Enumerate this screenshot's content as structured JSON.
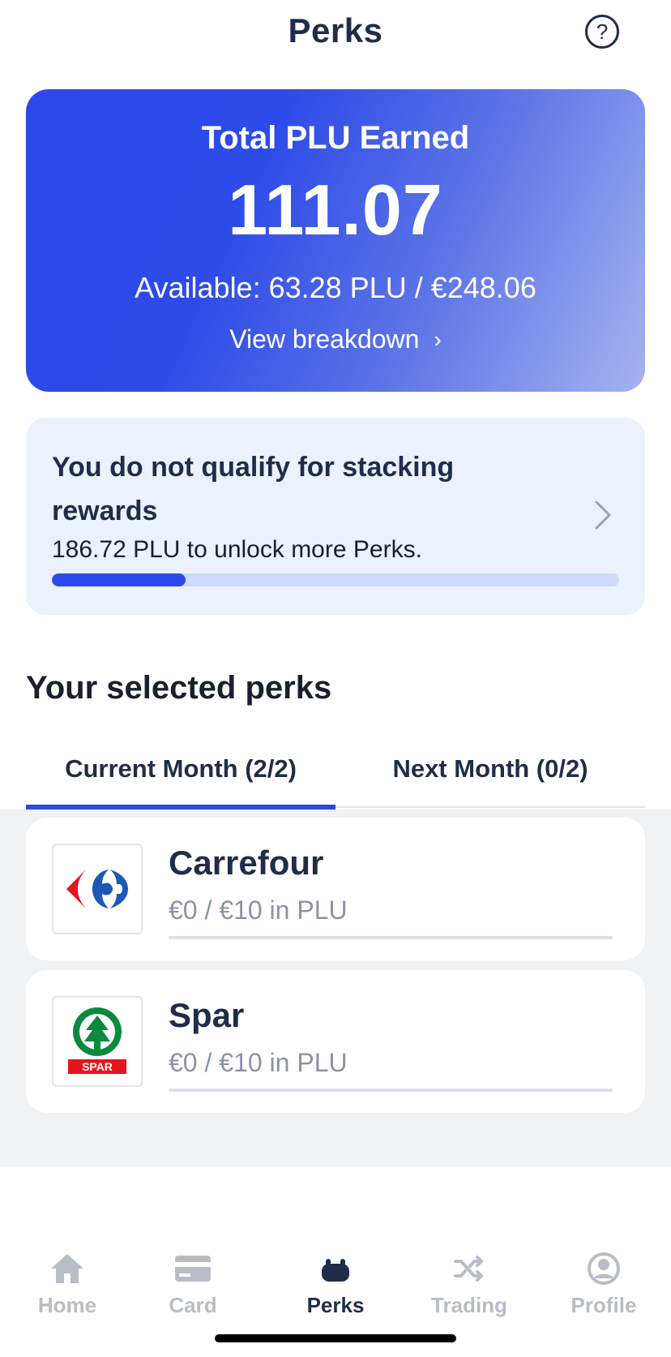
{
  "header": {
    "title": "Perks",
    "help_symbol": "?"
  },
  "hero": {
    "label": "Total PLU Earned",
    "value": "111.07",
    "available": "Available: 63.28 PLU / €248.06",
    "link_label": "View breakdown",
    "link_chevron": "›"
  },
  "stacking": {
    "title": "You do not qualify for stacking rewards",
    "subtitle": "186.72 PLU to unlock more Perks.",
    "progress_fraction": 0.236
  },
  "perks_section": {
    "title": "Your selected perks",
    "tabs": [
      {
        "label": "Current Month (2/2)",
        "active": true
      },
      {
        "label": "Next Month (0/2)",
        "active": false
      }
    ],
    "items": [
      {
        "name": "Carrefour",
        "amount": "€0 / €10 in PLU",
        "progress_fraction": 0,
        "logo": "carrefour-logo"
      },
      {
        "name": "Spar",
        "amount": "€0 / €10 in PLU",
        "progress_fraction": 0,
        "logo": "spar-logo",
        "logo_text": "SPAR"
      }
    ]
  },
  "bottom_nav": {
    "items": [
      {
        "label": "Home",
        "icon": "home-icon",
        "active": false
      },
      {
        "label": "Card",
        "icon": "card-icon",
        "active": false
      },
      {
        "label": "Perks",
        "icon": "perks-icon",
        "active": true
      },
      {
        "label": "Trading",
        "icon": "shuffle-icon",
        "active": false
      },
      {
        "label": "Profile",
        "icon": "profile-icon",
        "active": false
      }
    ]
  },
  "colors": {
    "accent": "#2b49ea",
    "text_dark": "#1f2d4a",
    "muted": "#8a93a6",
    "inactive_nav": "#b8bcc5",
    "carrefour_red": "#e4141f",
    "carrefour_blue": "#1d57b8",
    "spar_green": "#0b8a3e",
    "spar_red": "#e3161b"
  }
}
